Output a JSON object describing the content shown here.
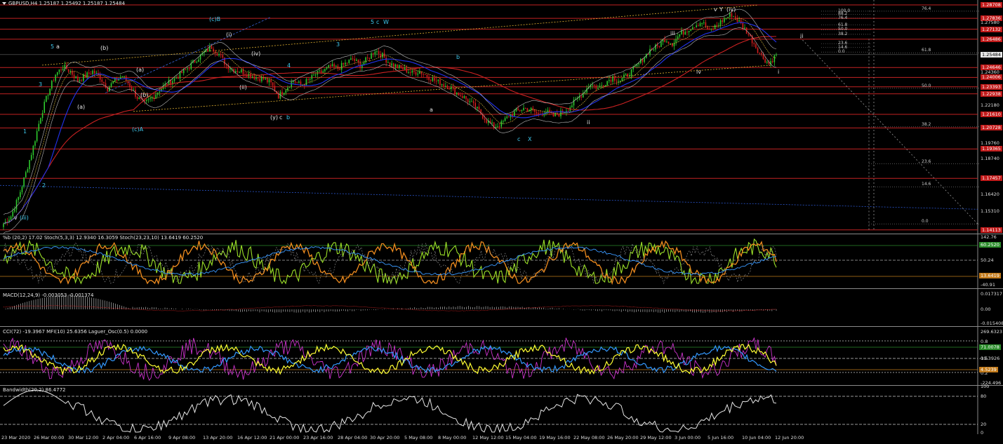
{
  "chart_data": [
    {
      "type": "line",
      "title": "GBPUSD,H4 1.25187 1.25492 1.25187 1.25484",
      "ylim": [
        1.141,
        1.288
      ],
      "price_labels": [
        {
          "text": "1.28708",
          "kind": "red"
        },
        {
          "text": "1.27836",
          "kind": "red"
        },
        {
          "text": "1.27580",
          "kind": "plain"
        },
        {
          "text": "1.27132",
          "kind": "red"
        },
        {
          "text": "1.26486",
          "kind": "red"
        },
        {
          "text": "1.25484",
          "kind": "cur"
        },
        {
          "text": "1.24646",
          "kind": "red"
        },
        {
          "text": "1.24360",
          "kind": "plain"
        },
        {
          "text": "1.24006",
          "kind": "red"
        },
        {
          "text": "1.23393",
          "kind": "red"
        },
        {
          "text": "1.22938",
          "kind": "red"
        },
        {
          "text": "1.22180",
          "kind": "plain"
        },
        {
          "text": "1.21610",
          "kind": "red"
        },
        {
          "text": "1.20728",
          "kind": "red"
        },
        {
          "text": "1.19760",
          "kind": "plain"
        },
        {
          "text": "1.19365",
          "kind": "red"
        },
        {
          "text": "1.18740",
          "kind": "plain"
        },
        {
          "text": "1.17457",
          "kind": "red"
        },
        {
          "text": "1.16420",
          "kind": "plain"
        },
        {
          "text": "1.15310",
          "kind": "plain"
        },
        {
          "text": "1.14113",
          "kind": "red"
        }
      ],
      "fib_left": [
        "100.0",
        "88.2",
        "76.4",
        "61.8",
        "50.0",
        "38.2",
        "23.6",
        "14.6",
        "0.0"
      ],
      "fib_right": [
        "76.4",
        "61.8",
        "50.0",
        "38.2",
        "23.6",
        "14.6",
        "0.0"
      ],
      "wave_labels": [
        "(c)B",
        "5",
        "a",
        "(b)",
        "(a)",
        "(b)",
        "(a)",
        "(c)A",
        "3",
        "(i)",
        "(iv)",
        "(ii)",
        "(y)",
        "c",
        "b",
        "4",
        "3",
        "5",
        "c",
        "W",
        "b",
        "a",
        "c",
        "X",
        "iii",
        "v",
        "Y",
        "(iv)",
        "iv",
        "ii",
        "ii",
        "i",
        "v",
        "(iii)",
        "1",
        "2"
      ],
      "close_series": [
        1.145,
        1.15,
        1.162,
        1.178,
        1.195,
        1.215,
        1.23,
        1.242,
        1.247,
        1.244,
        1.238,
        1.241,
        1.244,
        1.24,
        1.233,
        1.238,
        1.241,
        1.235,
        1.227,
        1.223,
        1.227,
        1.232,
        1.236,
        1.239,
        1.243,
        1.247,
        1.252,
        1.256,
        1.26,
        1.255,
        1.248,
        1.245,
        1.244,
        1.242,
        1.24,
        1.239,
        1.236,
        1.228,
        1.233,
        1.238,
        1.235,
        1.238,
        1.242,
        1.244,
        1.247,
        1.246,
        1.249,
        1.252,
        1.248,
        1.252,
        1.258,
        1.254,
        1.249,
        1.247,
        1.245,
        1.243,
        1.244,
        1.241,
        1.238,
        1.236,
        1.234,
        1.23,
        1.227,
        1.223,
        1.218,
        1.212,
        1.208,
        1.21,
        1.215,
        1.218,
        1.22,
        1.219,
        1.216,
        1.218,
        1.215,
        1.217,
        1.22,
        1.225,
        1.23,
        1.236,
        1.233,
        1.237,
        1.24,
        1.238,
        1.242,
        1.246,
        1.252,
        1.258,
        1.26,
        1.265,
        1.262,
        1.268,
        1.271,
        1.274,
        1.276,
        1.27,
        1.274,
        1.278,
        1.281,
        1.276,
        1.27,
        1.262,
        1.254,
        1.249,
        1.2548
      ]
    },
    {
      "type": "line",
      "title": "%b (20,2) 17.02  Stoch(5,3,3) 12.9340 16.3059  Stoch(23,23,10) 13.6419 60.2520",
      "axis_labels": [
        "142.76",
        "80",
        "50.24",
        "20",
        "-40.91"
      ],
      "tag_labels": [
        "60.2520",
        "13.6419"
      ]
    },
    {
      "type": "bar",
      "title": "MACD(12,24,9) -0.003053 -0.001374",
      "axis_labels": [
        "0.017317",
        "0.00",
        "-0.015408"
      ]
    },
    {
      "type": "line",
      "title": "CCI(72) -19.3967  MFI(10) 25.6356  Laguer_Osc(0.5) 0.0000",
      "axis_labels": [
        "269.6323",
        "0.8",
        "0.5",
        "0.2",
        "-224.496"
      ],
      "tag_labels": [
        "71.0078",
        "-19.3926",
        "4.5239"
      ]
    },
    {
      "type": "line",
      "title": "Bandwidth(20,2) 86.4772",
      "axis_labels": [
        "100",
        "80",
        "20",
        "0"
      ]
    }
  ],
  "x_axis": [
    "23 Mar 2020",
    "26 Mar 00:00",
    "30 Mar 12:00",
    "2 Apr 04:00",
    "6 Apr 16:00",
    "9 Apr 08:00",
    "13 Apr 20:00",
    "16 Apr 12:00",
    "21 Apr 00:00",
    "23 Apr 16:00",
    "28 Apr 04:00",
    "30 Apr 20:00",
    "5 May 08:00",
    "8 May 00:00",
    "12 May 12:00",
    "15 May 04:00",
    "19 May 16:00",
    "22 May 08:00",
    "26 May 20:00",
    "29 May 12:00",
    "3 Jun 00:00",
    "5 Jun 16:00",
    "10 Jun 04:00",
    "12 Jun 20:00"
  ],
  "colors": {
    "up": "#2ecc2e",
    "down": "#d81e1e",
    "level": "#c22222",
    "ma_blue": "#2233ee",
    "ma_red": "#cc2222",
    "stoch_green": "#9be028",
    "stoch_orange": "#f08c1e",
    "cci_yellow": "#ffff33",
    "cci_blue": "#3399ff",
    "mfi_magenta": "#cc33cc"
  }
}
